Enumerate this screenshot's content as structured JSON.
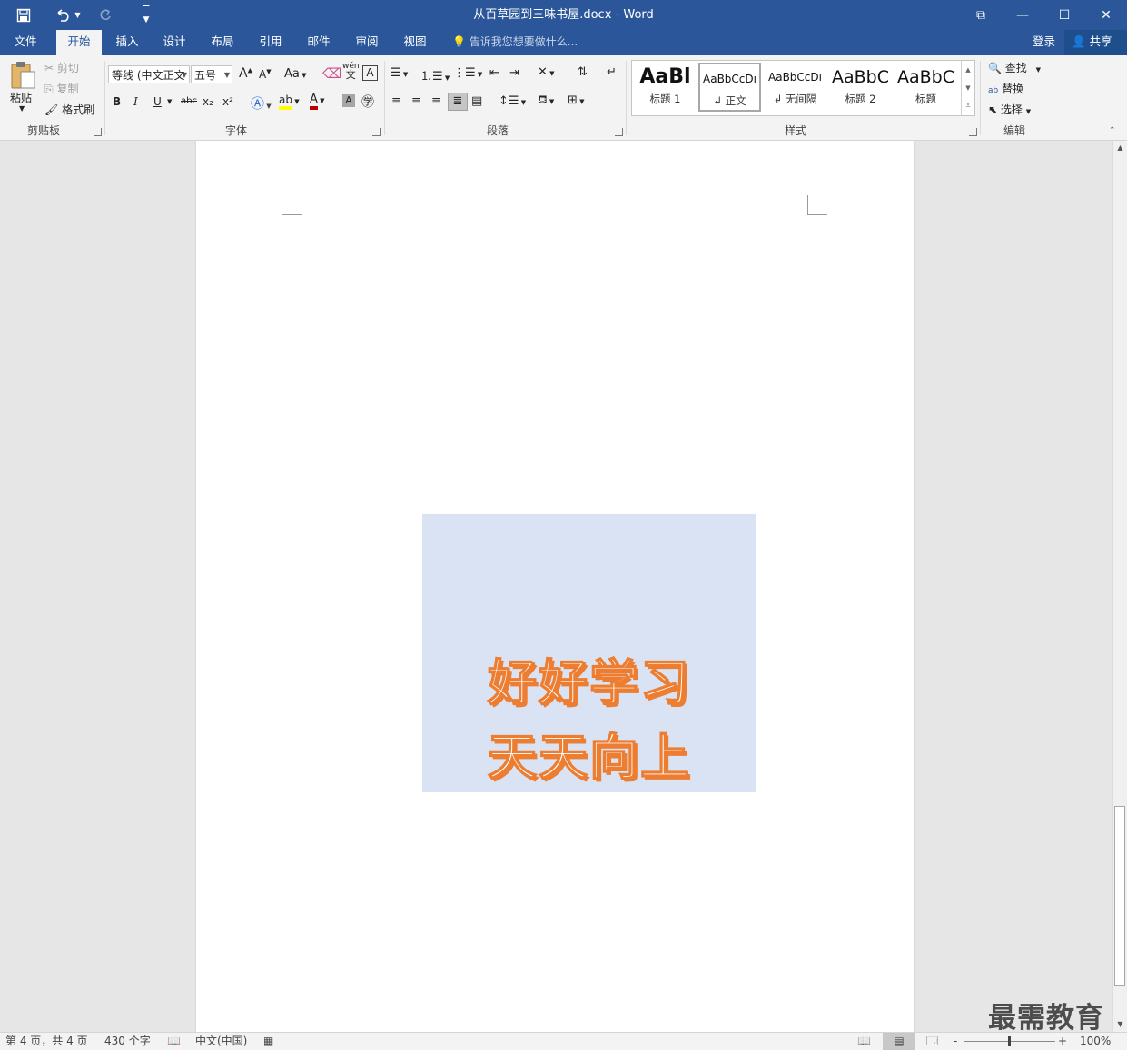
{
  "window": {
    "title": "从百草园到三味书屋.docx - Word",
    "minimize": "—",
    "maximize": "☐",
    "close": "✕",
    "ribbon_display": "⧉"
  },
  "tabs": [
    {
      "label": "文件"
    },
    {
      "label": "开始"
    },
    {
      "label": "插入"
    },
    {
      "label": "设计"
    },
    {
      "label": "布局"
    },
    {
      "label": "引用"
    },
    {
      "label": "邮件"
    },
    {
      "label": "审阅"
    },
    {
      "label": "视图"
    }
  ],
  "tellme": "告诉我您想要做什么...",
  "account": {
    "login": "登录",
    "share": "共享"
  },
  "ribbon": {
    "clipboard": {
      "label": "剪贴板",
      "paste": "粘贴",
      "cut": "剪切",
      "copy": "复制",
      "format_painter": "格式刷"
    },
    "font": {
      "label": "字体",
      "font_name": "等线 (中文正文",
      "font_size": "五号",
      "grow": "A",
      "shrink": "A",
      "case": "Aa",
      "bold": "B",
      "italic": "I",
      "underline": "U",
      "strike": "abc",
      "sub": "x₂",
      "sup": "x²",
      "phonetic": "wén"
    },
    "paragraph": {
      "label": "段落"
    },
    "styles": {
      "label": "样式",
      "items": [
        {
          "sample": "AaBl",
          "name": "标题 1"
        },
        {
          "sample": "AaBbCcDı",
          "name": "↲ 正文"
        },
        {
          "sample": "AaBbCcDı",
          "name": "↲ 无间隔"
        },
        {
          "sample": "AaBbC",
          "name": "标题 2"
        },
        {
          "sample": "AaBbC",
          "name": "标题"
        }
      ]
    },
    "editing": {
      "label": "编辑",
      "find": "查找",
      "replace": "替换",
      "select": "选择"
    }
  },
  "document": {
    "wordart_line1": "好好学习",
    "wordart_line2": "天天向上"
  },
  "status": {
    "page": "第 4 页，共 4 页",
    "words": "430 个字",
    "language": "中文(中国)",
    "zoom": "100%",
    "zoom_minus": "-",
    "zoom_plus": "+"
  },
  "watermark": "最需教育",
  "colors": {
    "brand": "#2b579a",
    "wordart_outline": "#ed7d31",
    "image_bg": "#dae3f3"
  }
}
